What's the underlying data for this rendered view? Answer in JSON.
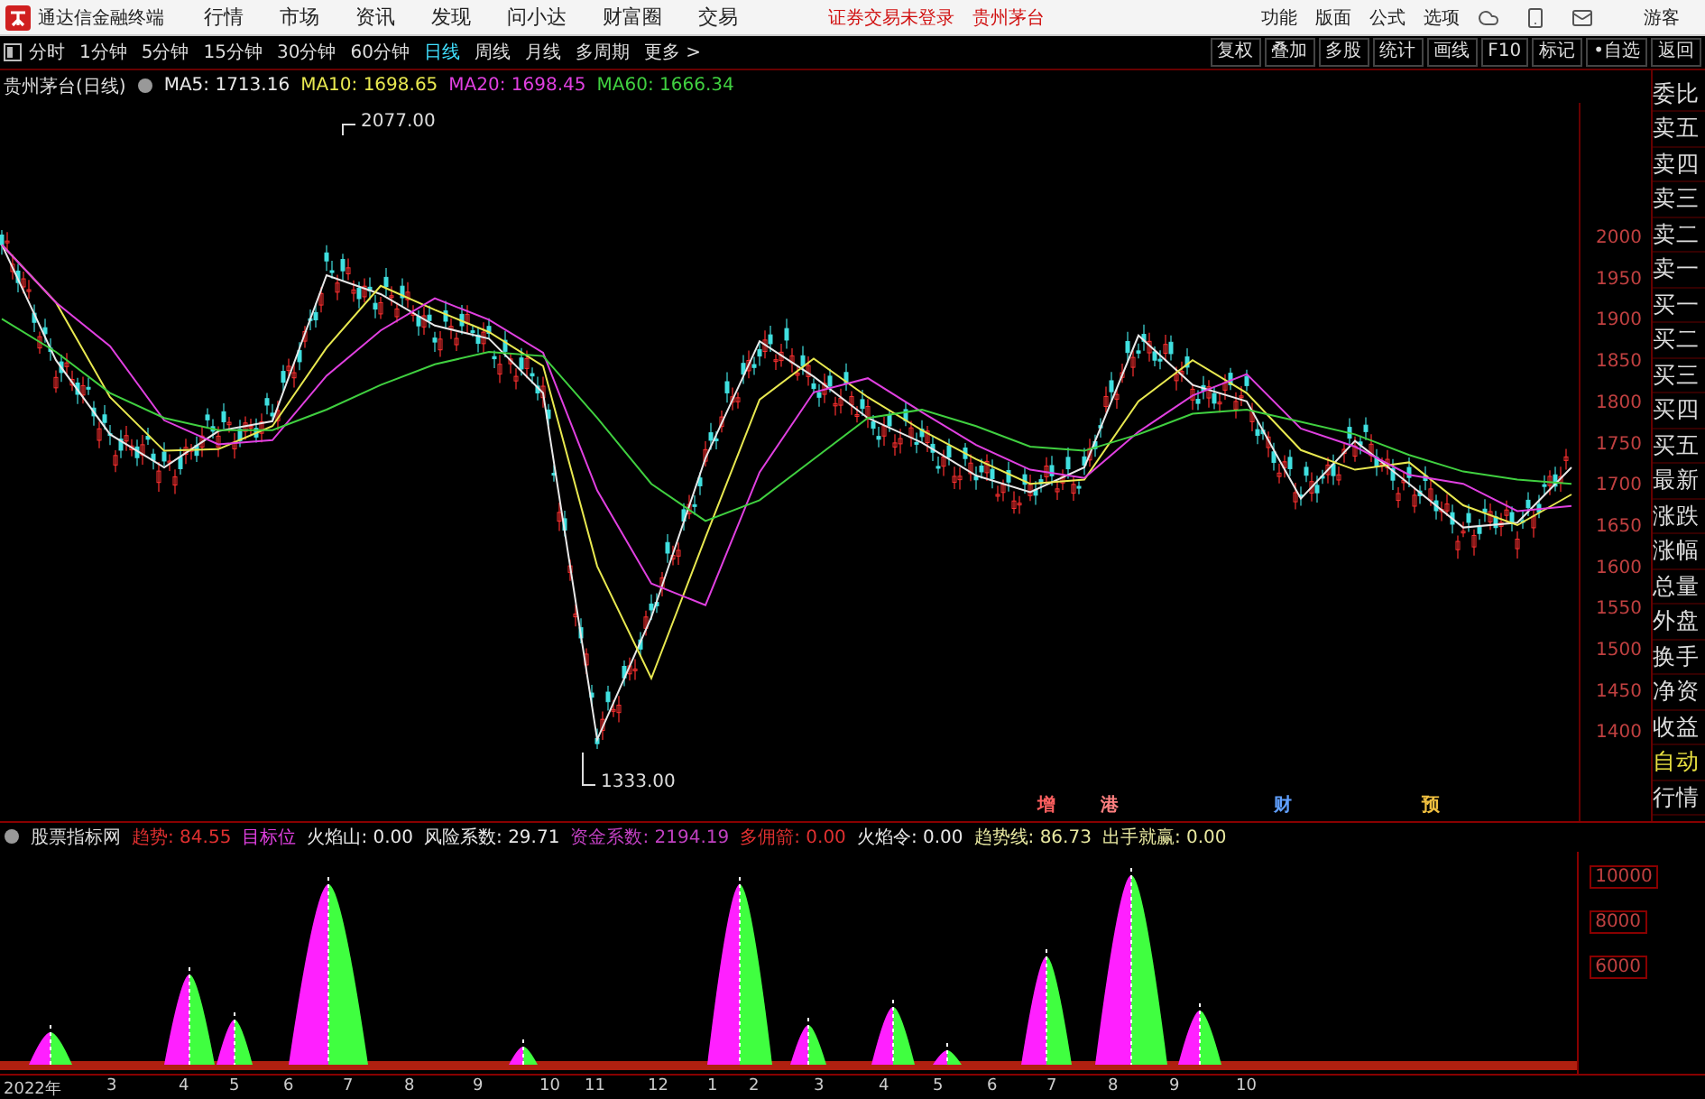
{
  "menu_bar": {
    "app_title": "通达信金融终端",
    "menus": [
      "行情",
      "市场",
      "资讯",
      "发现",
      "问小达",
      "财富圈",
      "交易"
    ],
    "notices": [
      "证券交易未登录",
      "贵州茅台"
    ],
    "right_menus": [
      "功能",
      "版面",
      "公式",
      "选项"
    ],
    "user": "游客"
  },
  "toolbar": {
    "periods": [
      {
        "label": "分时",
        "selected": false
      },
      {
        "label": "1分钟",
        "selected": false
      },
      {
        "label": "5分钟",
        "selected": false
      },
      {
        "label": "15分钟",
        "selected": false
      },
      {
        "label": "30分钟",
        "selected": false
      },
      {
        "label": "60分钟",
        "selected": false
      },
      {
        "label": "日线",
        "selected": true
      },
      {
        "label": "周线",
        "selected": false
      },
      {
        "label": "月线",
        "selected": false
      },
      {
        "label": "多周期",
        "selected": false
      },
      {
        "label": "更多 >",
        "selected": false
      }
    ],
    "buttons": [
      "复权",
      "叠加",
      "多股",
      "统计",
      "画线",
      "F10",
      "标记",
      "•自选",
      "返回"
    ]
  },
  "price_chart": {
    "title": "贵州茅台(日线)",
    "readings": [
      ": 1713.16",
      ": 1698.65",
      ": 1698.45",
      ": 1666.34"
    ],
    "high_label": "2077.00",
    "low_label": "1333.00",
    "chart_data": {
      "type": "line",
      "ylim": [
        1291,
        2162
      ],
      "yticks": [
        2000,
        1950,
        1900,
        1850,
        1800,
        1750,
        1700,
        1650,
        1600,
        1550,
        1500,
        1450,
        1400
      ],
      "series": [
        {
          "name": "MA5",
          "color": "#e8e8e8",
          "values": [
            1990,
            1850,
            1760,
            1720,
            1764,
            1776,
            1953,
            1930,
            1892,
            1876,
            1810,
            1390,
            1538,
            1731,
            1873,
            1830,
            1780,
            1750,
            1710,
            1690,
            1720,
            1880,
            1820,
            1800,
            1682,
            1752,
            1700,
            1647,
            1653,
            1720
          ]
        },
        {
          "name": "MA10",
          "color": "#e8e850",
          "values": [
            1990,
            1920,
            1805,
            1740,
            1742,
            1770,
            1865,
            1940,
            1911,
            1884,
            1843,
            1600,
            1464,
            1635,
            1802,
            1852,
            1805,
            1765,
            1730,
            1700,
            1705,
            1800,
            1850,
            1810,
            1741,
            1717,
            1726,
            1674,
            1650,
            1687
          ]
        },
        {
          "name": "MA20",
          "color": "#e040e0",
          "values": [
            1990,
            1920,
            1867,
            1777,
            1748,
            1753,
            1831,
            1886,
            1925,
            1899,
            1859,
            1692,
            1579,
            1553,
            1714,
            1811,
            1828,
            1787,
            1747,
            1717,
            1707,
            1763,
            1807,
            1833,
            1767,
            1745,
            1711,
            1700,
            1667,
            1673
          ]
        },
        {
          "name": "MA60",
          "color": "#40d040",
          "values": [
            1900,
            1860,
            1810,
            1780,
            1765,
            1765,
            1790,
            1820,
            1845,
            1860,
            1855,
            1780,
            1700,
            1655,
            1680,
            1730,
            1780,
            1790,
            1770,
            1745,
            1740,
            1760,
            1785,
            1790,
            1775,
            1760,
            1735,
            1715,
            1705,
            1700
          ]
        }
      ]
    },
    "event_marks": [
      {
        "label": "增",
        "color": "#ff6060"
      },
      {
        "label": "港",
        "color": "#ff8080"
      },
      {
        "label": "财",
        "color": "#60a0ff"
      },
      {
        "label": "预",
        "color": "#f0c040"
      }
    ]
  },
  "sidebar": [
    {
      "label": "委比",
      "active": false
    },
    {
      "label": "卖五",
      "active": false
    },
    {
      "label": "卖四",
      "active": false
    },
    {
      "label": "卖三",
      "active": false
    },
    {
      "label": "卖二",
      "active": false
    },
    {
      "label": "卖一",
      "active": false
    },
    {
      "label": "买一",
      "active": false
    },
    {
      "label": "买二",
      "active": false
    },
    {
      "label": "买三",
      "active": false
    },
    {
      "label": "买四",
      "active": false
    },
    {
      "label": "买五",
      "active": false
    },
    {
      "label": "最新",
      "active": false
    },
    {
      "label": "涨跌",
      "active": false
    },
    {
      "label": "涨幅",
      "active": false
    },
    {
      "label": "总量",
      "active": false
    },
    {
      "label": "外盘",
      "active": false
    },
    {
      "label": "换手",
      "active": false
    },
    {
      "label": "净资",
      "active": false
    },
    {
      "label": "收益",
      "active": false
    },
    {
      "label": "自动",
      "active": true
    },
    {
      "label": "行情",
      "active": false
    }
  ],
  "indicator": {
    "title": "股票指标网",
    "readings": [
      {
        "label": "趋势: 84.55",
        "color": "#e03030"
      },
      {
        "label": "目标位",
        "color": "#e040e0"
      },
      {
        "label": "火焰山: 0.00",
        "color": "#e8e8e8"
      },
      {
        "label": "风险系数: 29.71",
        "color": "#e8e8e8"
      },
      {
        "label": "资金系数: 2194.19",
        "color": "#c040c0"
      },
      {
        "label": "多佣箭: 0.00",
        "color": "#e03030"
      },
      {
        "label": "火焰令: 0.00",
        "color": "#e8e8e8"
      },
      {
        "label": "趋势线: 86.73",
        "color": "#e8e8a0"
      },
      {
        "label": "出手就赢: 0.00",
        "color": "#e8e8a0"
      }
    ],
    "y_ticks": [
      "10000",
      "8000",
      "6000"
    ]
  },
  "date_axis": [
    "2022年",
    "3",
    "4",
    "5",
    "6",
    "7",
    "8",
    "9",
    "10",
    "11",
    "12",
    "1",
    "2",
    "3",
    "4",
    "5",
    "6",
    "7",
    "8",
    "9",
    "10"
  ]
}
